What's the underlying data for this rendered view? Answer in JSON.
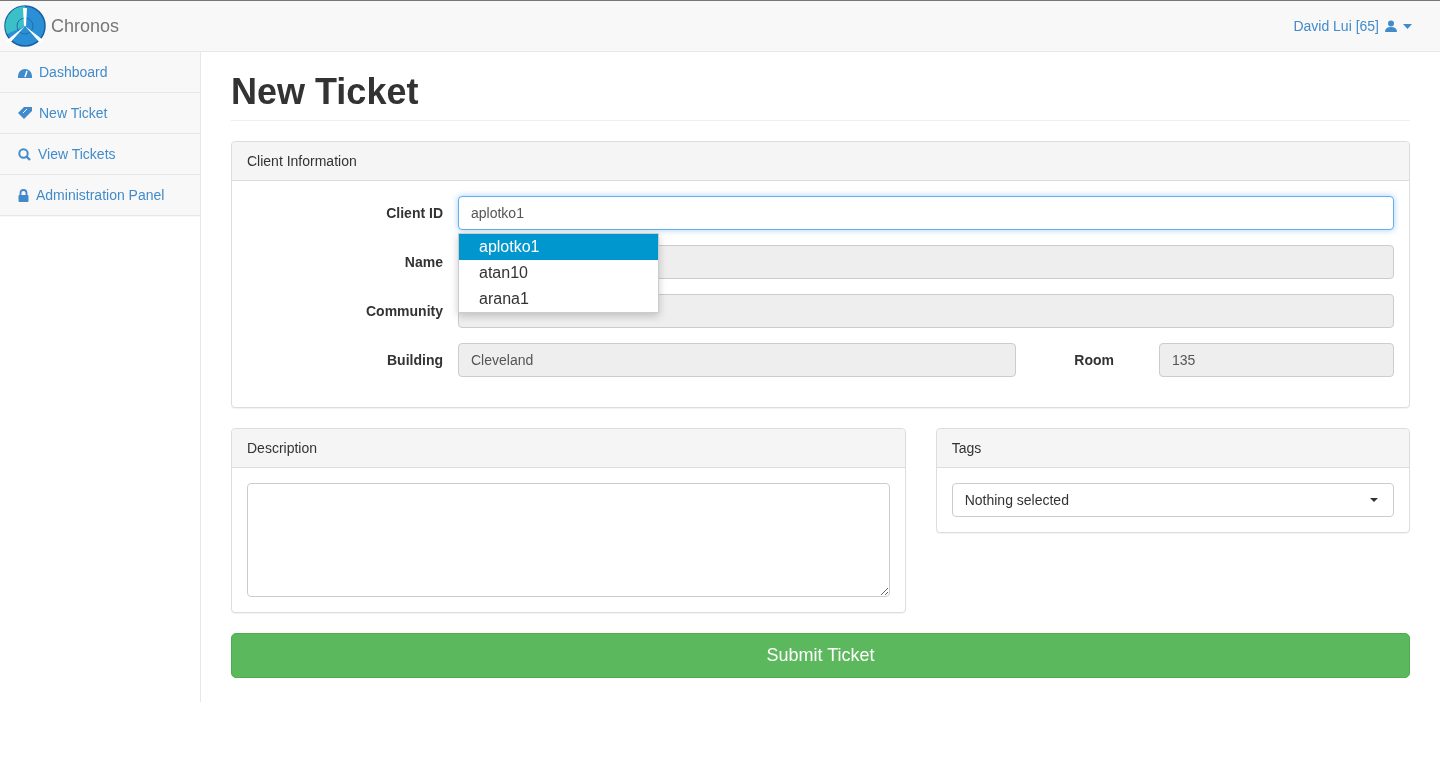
{
  "navbar": {
    "brand": "Chronos",
    "user": "David Lui [65]"
  },
  "sidebar": {
    "items": [
      {
        "label": "Dashboard",
        "selected": false
      },
      {
        "label": "New Ticket",
        "selected": false
      },
      {
        "label": "View Tickets",
        "selected": false
      },
      {
        "label": "Administration Panel",
        "selected": false
      }
    ]
  },
  "title": "New Ticket",
  "client_panel": {
    "heading": "Client Information",
    "client_id": {
      "label": "Client ID",
      "value": "aplotko1"
    },
    "suggestions": [
      {
        "label": "aplotko1",
        "selected": true
      },
      {
        "label": "atan10",
        "selected": false
      },
      {
        "label": "arana1",
        "selected": false
      }
    ],
    "name": {
      "label": "Name"
    },
    "community": {
      "label": "Community"
    },
    "building": {
      "label": "Building",
      "value": "Cleveland"
    },
    "room": {
      "label": "Room",
      "value": "135"
    }
  },
  "description_panel": {
    "heading": "Description"
  },
  "tags_panel": {
    "heading": "Tags",
    "select": "Nothing selected"
  },
  "submit": "Submit Ticket"
}
